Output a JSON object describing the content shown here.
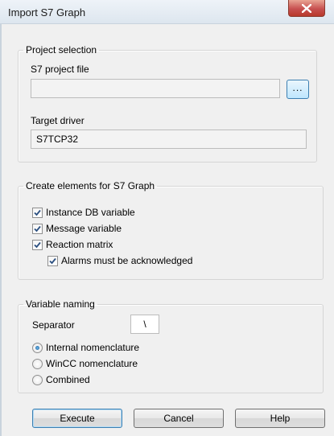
{
  "window": {
    "title": "Import S7 Graph"
  },
  "project_selection": {
    "legend": "Project selection",
    "project_file_label": "S7 project file",
    "project_file_value": "",
    "browse_label": "...",
    "target_driver_label": "Target driver",
    "target_driver_value": "S7TCP32"
  },
  "create_elements": {
    "legend": "Create elements for S7 Graph",
    "options": [
      {
        "label": "Instance DB variable",
        "checked": true
      },
      {
        "label": "Message variable",
        "checked": true
      },
      {
        "label": "Reaction matrix",
        "checked": true
      },
      {
        "label": "Alarms must be acknowledged",
        "checked": true
      }
    ]
  },
  "variable_naming": {
    "legend": "Variable naming",
    "separator_label": "Separator",
    "separator_value": "\\",
    "options": [
      {
        "label": "Internal nomenclature",
        "selected": true
      },
      {
        "label": "WinCC nomenclature",
        "selected": false
      },
      {
        "label": "Combined",
        "selected": false
      }
    ]
  },
  "buttons": {
    "execute": "Execute",
    "cancel": "Cancel",
    "help": "Help"
  }
}
